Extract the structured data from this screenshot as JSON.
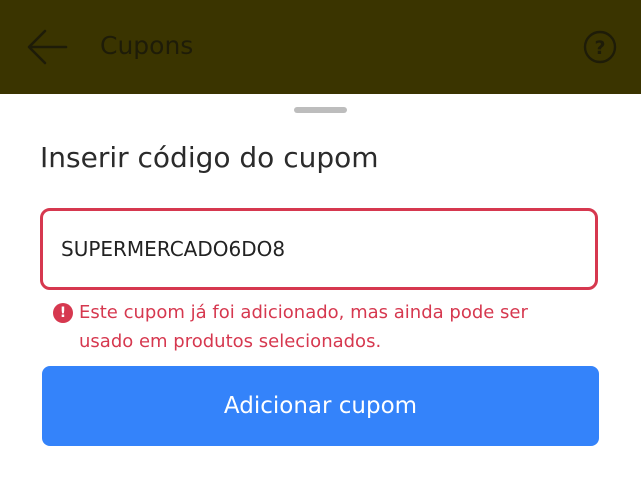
{
  "app_bar": {
    "title": "Cupons",
    "back_icon": "arrow-left-icon",
    "help_icon": "question-circle-icon",
    "background": "#3a3400"
  },
  "sheet": {
    "title": "Inserir código do cupom",
    "coupon_input": {
      "value": "SUPERMERCADO6DO8",
      "state": "error",
      "border_color": "#d6384f"
    },
    "error": {
      "icon": "exclamation-circle-icon",
      "icon_glyph": "!",
      "message": "Este cupom já foi adicionado, mas ainda pode ser usado em produtos selecionados.",
      "color": "#d6384f"
    },
    "add_button_label": "Adicionar cupom",
    "accent_color": "#3483fa"
  }
}
